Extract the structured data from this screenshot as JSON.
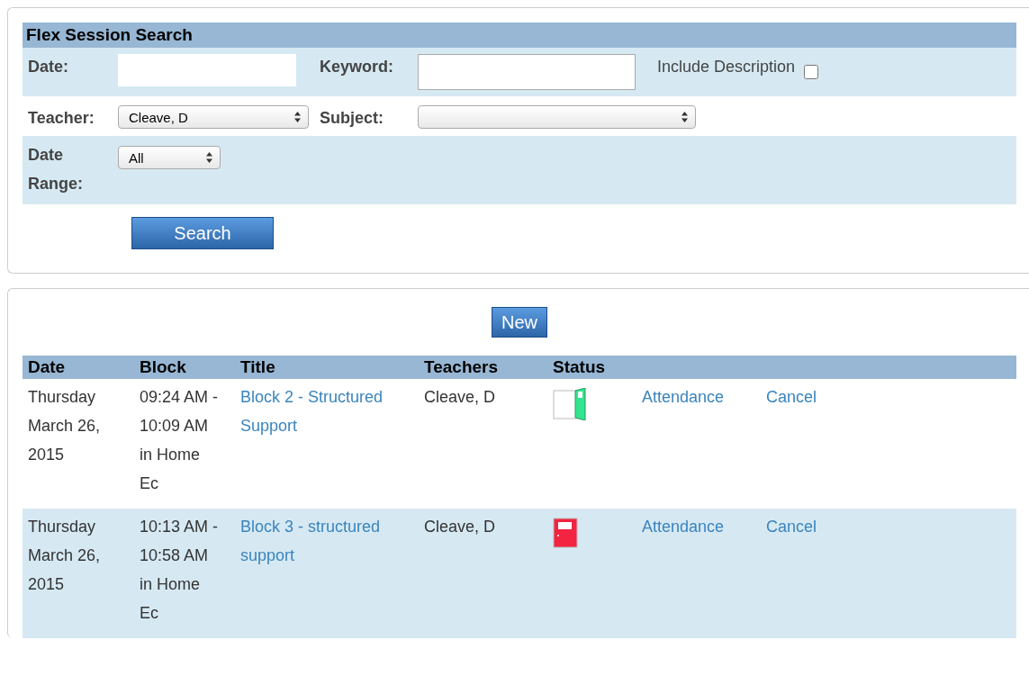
{
  "search_panel": {
    "title": "Flex Session Search",
    "date": {
      "label": "Date:"
    },
    "keyword": {
      "label": "Keyword:"
    },
    "include_description": {
      "label": "Include Description",
      "checked": false
    },
    "teacher": {
      "label": "Teacher:",
      "value": "Cleave, D"
    },
    "subject": {
      "label": "Subject:"
    },
    "date_range": {
      "label_lines": [
        "Date",
        "Range:"
      ],
      "value": "All"
    },
    "search_button": "Search"
  },
  "results": {
    "new_button": "New",
    "columns": [
      "Date",
      "Block",
      "Title",
      "Teachers",
      "Status"
    ],
    "rows": [
      {
        "date": "Thursday March 26, 2015",
        "block": "09:24 AM - 10:09 AM",
        "location": "in Home Ec",
        "title": "Block 2 - Structured Support",
        "teachers": "Cleave, D",
        "door_open": true,
        "actions": [
          "Attendance",
          "Cancel"
        ]
      },
      {
        "date": "Thursday March 26, 2015",
        "block": "10:13 AM - 10:58 AM",
        "location": "in Home Ec",
        "title": "Block 3 - structured support",
        "teachers": "Cleave, D",
        "door_open": false,
        "actions": [
          "Attendance",
          "Cancel"
        ]
      }
    ]
  }
}
